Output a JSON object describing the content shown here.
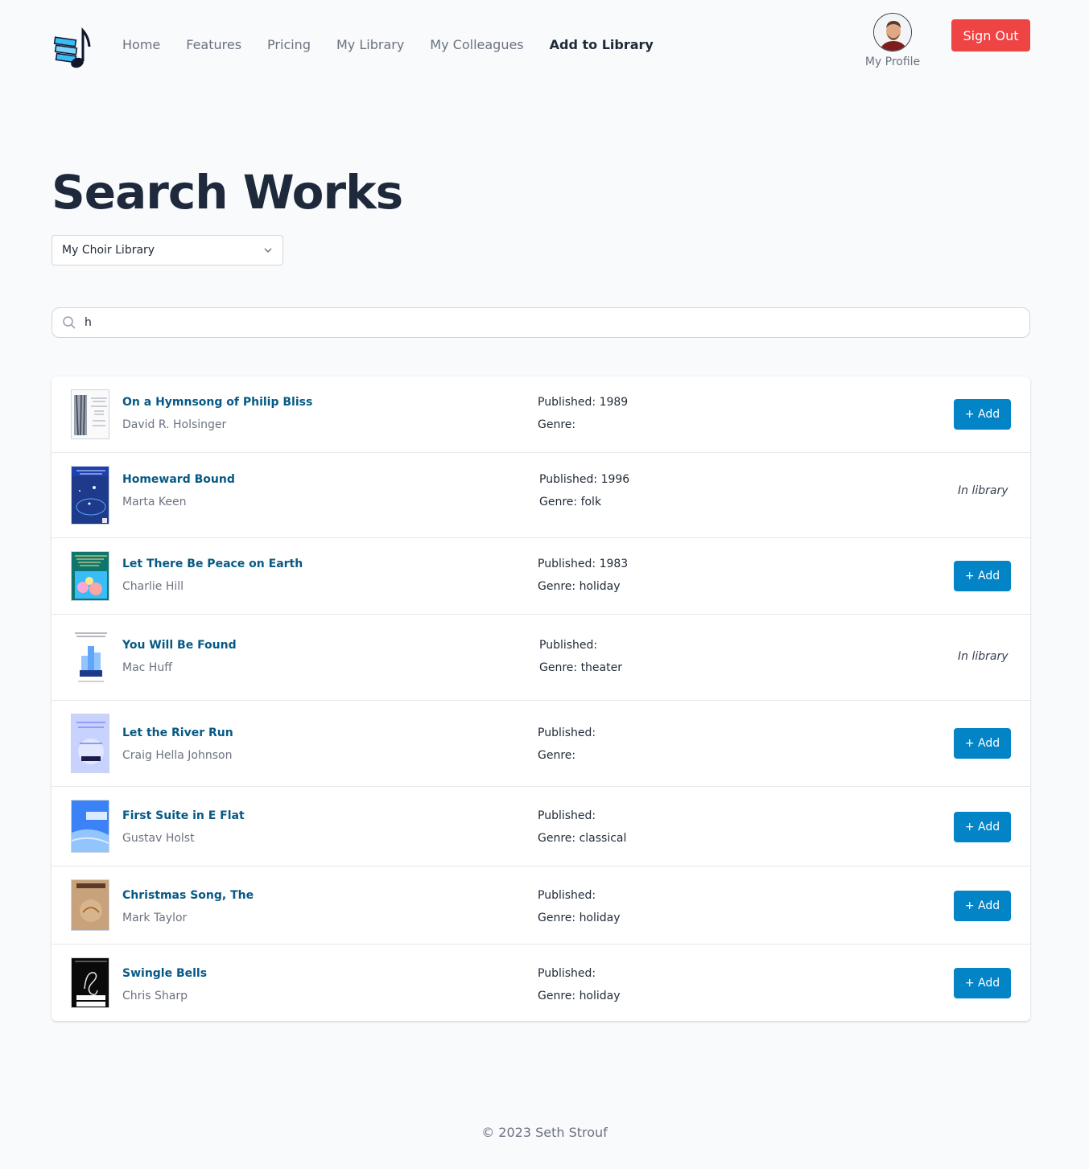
{
  "nav": {
    "items": [
      {
        "label": "Home",
        "active": false
      },
      {
        "label": "Features",
        "active": false
      },
      {
        "label": "Pricing",
        "active": false
      },
      {
        "label": "My Library",
        "active": false
      },
      {
        "label": "My Colleagues",
        "active": false
      },
      {
        "label": "Add to Library",
        "active": true
      }
    ],
    "profile_label": "My Profile",
    "signout_label": "Sign Out"
  },
  "page": {
    "title": "Search Works",
    "library_select_value": "My Choir Library",
    "search_value": "h"
  },
  "results": [
    {
      "title": "On a Hymnsong of Philip Bliss",
      "composer": "David R. Holsinger",
      "published": "Published: 1989",
      "genre": "Genre:",
      "status": "add",
      "add_label": "+ Add"
    },
    {
      "title": "Homeward Bound",
      "composer": "Marta Keen",
      "published": "Published: 1996",
      "genre": "Genre: folk",
      "status": "in_library",
      "in_library_label": "In library"
    },
    {
      "title": "Let There Be Peace on Earth",
      "composer": "Charlie Hill",
      "published": "Published: 1983",
      "genre": "Genre: holiday",
      "status": "add",
      "add_label": "+ Add"
    },
    {
      "title": "You Will Be Found",
      "composer": "Mac Huff",
      "published": "Published:",
      "genre": "Genre: theater",
      "status": "in_library",
      "in_library_label": "In library"
    },
    {
      "title": "Let the River Run",
      "composer": "Craig Hella Johnson",
      "published": "Published:",
      "genre": "Genre:",
      "status": "add",
      "add_label": "+ Add"
    },
    {
      "title": "First Suite in E Flat",
      "composer": "Gustav Holst",
      "published": "Published:",
      "genre": "Genre: classical",
      "status": "add",
      "add_label": "+ Add"
    },
    {
      "title": "Christmas Song, The",
      "composer": "Mark Taylor",
      "published": "Published:",
      "genre": "Genre: holiday",
      "status": "add",
      "add_label": "+ Add"
    },
    {
      "title": "Swingle Bells",
      "composer": "Chris Sharp",
      "published": "Published:",
      "genre": "Genre: holiday",
      "status": "add",
      "add_label": "+ Add"
    }
  ],
  "footer": "© 2023 Seth Strouf",
  "colors": {
    "accent": "#0284c7",
    "signout": "#ef4444",
    "link": "#075985"
  }
}
